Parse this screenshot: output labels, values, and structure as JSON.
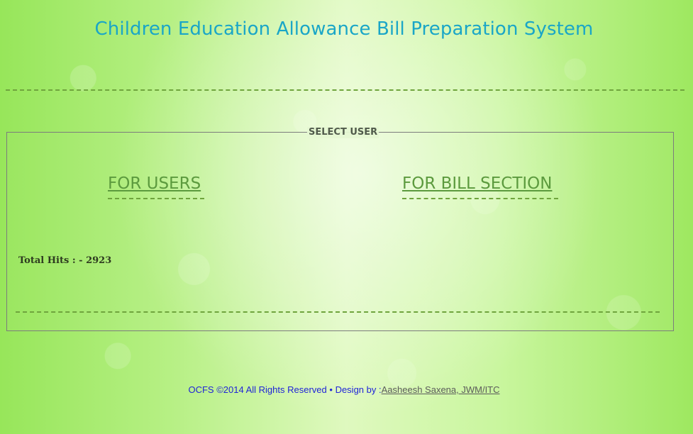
{
  "header": {
    "title": "Children Education Allowance Bill Preparation System"
  },
  "select_user": {
    "legend": "SELECT USER",
    "for_users_label": "FOR USERS",
    "for_bill_section_label": "FOR BILL SECTION",
    "total_hits": "Total Hits : - 2923"
  },
  "footer": {
    "copyright": "OCFS ©2014 All Rights Reserved",
    "separator": "•",
    "design_by": "Design by :",
    "designer_link": "Aasheesh Saxena, JWM/ITC"
  },
  "colors": {
    "title": "#1aa6c7",
    "link": "#5c9a3e",
    "footer_text": "#1f24d8",
    "divider": "#6fa43d"
  }
}
